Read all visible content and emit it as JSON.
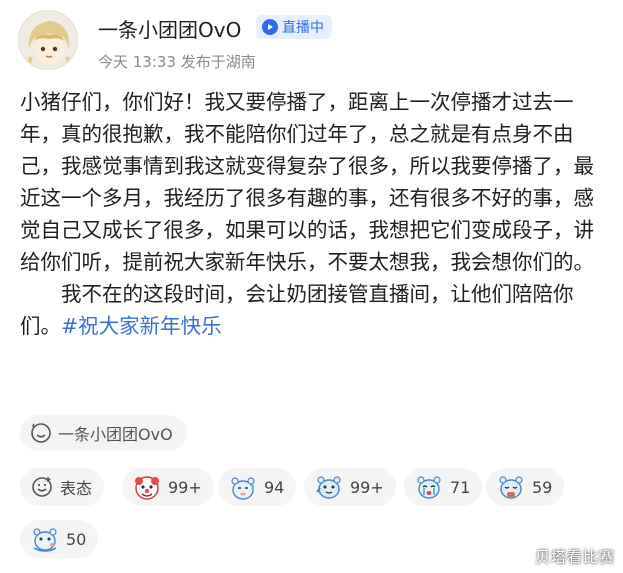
{
  "post": {
    "author": "一条小团团OvO",
    "live_badge": "直播中",
    "time": "今天 13:33",
    "location": "发布于湖南",
    "paragraph1": "小猪仔们，你们好！我又要停播了，距离上一次停播才过去一年，真的很抱歉，我不能陪你们过年了，总之就是有点身不由己，我感觉事情到我这就变得复杂了很多，所以我要停播了，最近这一个多月，我经历了很多有趣的事，还有很多不好的事，感觉自己又成长了很多，如果可以的话，我想把它们变成段子，讲给你们听，提前祝大家新年快乐，不要太想我，我会想你们的。",
    "paragraph2": "　　我不在的这段时间，会让奶团接管直播间，让他们陪陪你们。",
    "hashtag": "#祝大家新年快乐"
  },
  "source_chip": {
    "label": "一条小团团OvO",
    "icon": "smiley-outline-icon"
  },
  "reactions": {
    "add_label": "表态",
    "items": [
      {
        "emoji": "clown-emoji",
        "count": "99+"
      },
      {
        "emoji": "bear-sweat-emoji",
        "count": "94"
      },
      {
        "emoji": "bear-wave-emoji",
        "count": "99+"
      },
      {
        "emoji": "bear-cry-emoji",
        "count": "71"
      },
      {
        "emoji": "bear-hug-emoji",
        "count": "59"
      },
      {
        "emoji": "bear-sit-emoji",
        "count": "50"
      }
    ]
  },
  "watermark": "贝塔看比赛",
  "colors": {
    "accent": "#3a6fd6",
    "badge_bg": "#e8f0ff",
    "chip_bg": "#f4f4f4"
  }
}
